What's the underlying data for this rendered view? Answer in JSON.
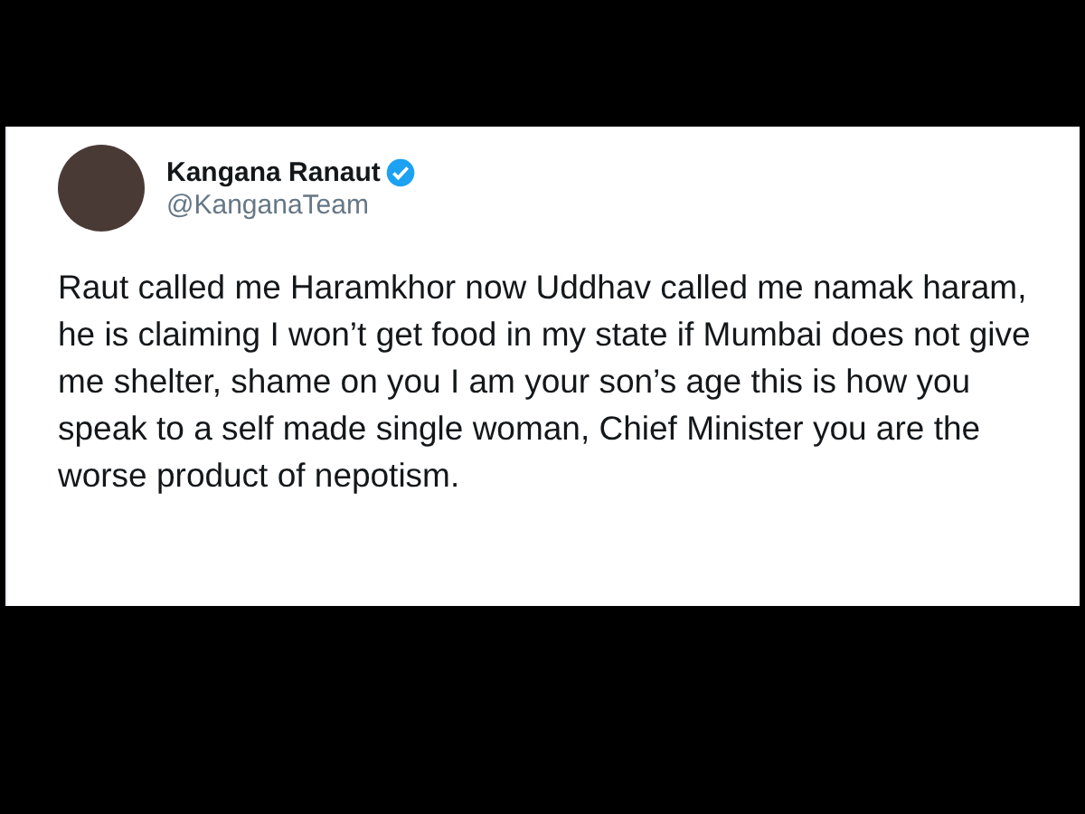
{
  "tweet": {
    "author": {
      "name": "Kangana Ranaut",
      "handle": "@KanganaTeam",
      "verified": true
    },
    "text": "Raut called me Haramkhor now Uddhav called me namak haram, he is claiming I won’t get food in my state if Mumbai does not give me shelter, shame on you I am your son’s age this is how you speak to a self made single woman, Chief Minister you are the worse product of nepotism."
  }
}
